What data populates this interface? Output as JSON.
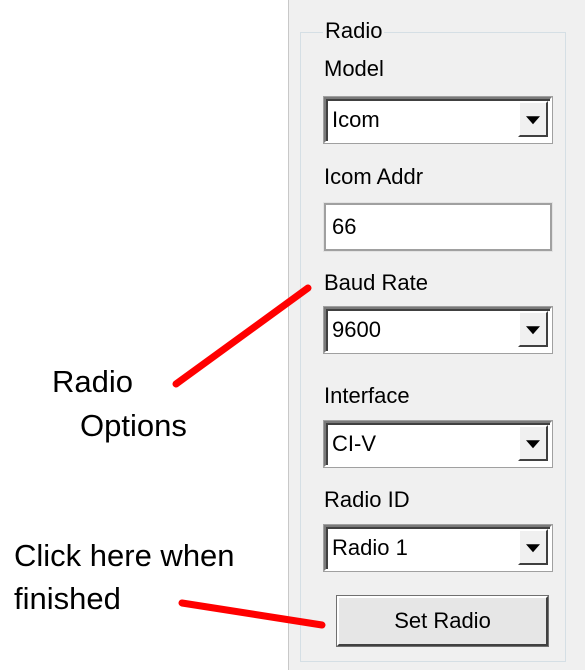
{
  "group": {
    "title": "Radio"
  },
  "fields": {
    "model": {
      "label": "Model",
      "value": "Icom"
    },
    "icom_addr": {
      "label": "Icom Addr",
      "value": "66"
    },
    "baud_rate": {
      "label": "Baud Rate",
      "value": "9600"
    },
    "interface": {
      "label": "Interface",
      "value": "CI-V"
    },
    "radio_id": {
      "label": "Radio ID",
      "value": "Radio 1"
    }
  },
  "set_button": {
    "label": "Set Radio"
  },
  "annotations": {
    "radio_options_line1": "Radio",
    "radio_options_line2": "Options",
    "click_here_line1": "Click here when",
    "click_here_line2": "finished"
  },
  "colors": {
    "pointer": "#ff0000",
    "panel": "#f0f0f0"
  }
}
